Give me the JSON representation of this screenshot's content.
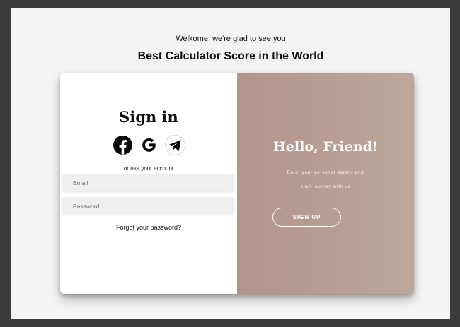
{
  "header": {
    "welcome": "Welkome, we're glad to see you",
    "headline": "Best Calculator Score in the World"
  },
  "signin_panel": {
    "title": "Sign in",
    "social_icons": [
      "facebook-icon",
      "google-icon",
      "telegram-icon"
    ],
    "alt_text": "or use your account",
    "email_placeholder": "Email",
    "password_placeholder": "Password",
    "forgot_link": "Forgot your password?"
  },
  "signup_panel": {
    "title": "Hello, Friend!",
    "desc_line1": "Enter your personal details and",
    "desc_line2": "start journey with us",
    "button_label": "SIGN UP"
  },
  "colors": {
    "page_bg": "#f4f4f4",
    "frame_bg": "#3b3b3b",
    "overlay_gradient_start": "#b2958b",
    "overlay_gradient_end": "#bca89b",
    "input_bg": "#eef0ef"
  }
}
